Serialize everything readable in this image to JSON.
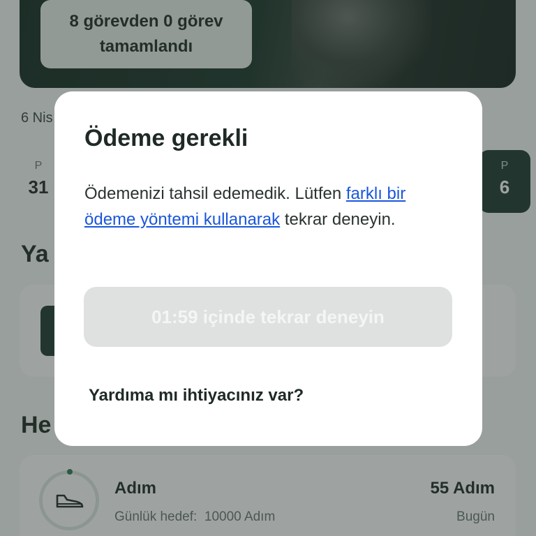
{
  "background": {
    "hero_badge": "8 görevden 0 görev tamamlandı",
    "date_label": "6 Nis",
    "week": {
      "left_day": {
        "label": "P",
        "number": "31"
      },
      "right_day": {
        "label": "P",
        "number": "6"
      }
    },
    "section_partial_1": "Ya",
    "section_partial_2": "He",
    "goal": {
      "name": "Adım",
      "daily_target_label": "Günlük hedef:",
      "daily_target_value": "10000 Adım",
      "value": "55 Adım",
      "when": "Bugün"
    }
  },
  "modal": {
    "title": "Ödeme gerekli",
    "body_prefix": "Ödemenizi tahsil edemedik. Lütfen ",
    "body_link": "farklı bir ödeme yöntemi kullanarak",
    "body_suffix": " tekrar deneyin.",
    "retry_button": "01:59 içinde tekrar deneyin",
    "help_link": "Yardıma mı ihtiyacınız var?"
  },
  "colors": {
    "link": "#1a56db",
    "accent_dark_green": "#1e3a30",
    "disabled_button": "#dfe1e1"
  }
}
